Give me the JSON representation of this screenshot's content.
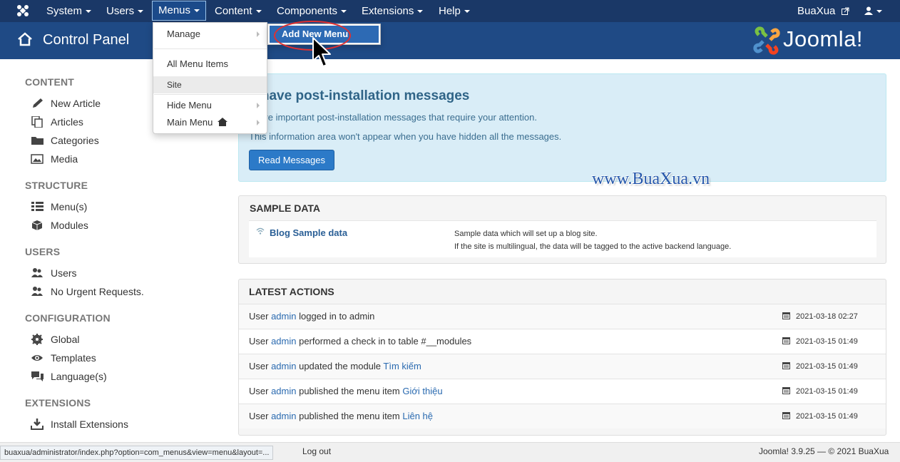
{
  "navbar": {
    "items": [
      {
        "label": "System"
      },
      {
        "label": "Users"
      },
      {
        "label": "Menus"
      },
      {
        "label": "Content"
      },
      {
        "label": "Components"
      },
      {
        "label": "Extensions"
      },
      {
        "label": "Help"
      }
    ],
    "site_link": "BuaXua",
    "user_icon": "user-icon"
  },
  "header": {
    "title": "Control Panel",
    "brand": "Joomla!"
  },
  "menus_dropdown": {
    "items": [
      {
        "label": "Manage",
        "has_submenu": true
      },
      {
        "label": "All Menu Items"
      },
      {
        "label": "Site"
      },
      {
        "label": "Hide Menu",
        "has_submenu": true
      },
      {
        "label": "Main Menu",
        "has_submenu": true
      }
    ],
    "submenu": {
      "label": "Add New Menu"
    }
  },
  "sidebar": {
    "sections": [
      {
        "heading": "CONTENT",
        "items": [
          {
            "label": "New Article",
            "icon": "pencil-icon"
          },
          {
            "label": "Articles",
            "icon": "copy-icon"
          },
          {
            "label": "Categories",
            "icon": "folder-icon"
          },
          {
            "label": "Media",
            "icon": "image-icon"
          }
        ]
      },
      {
        "heading": "STRUCTURE",
        "items": [
          {
            "label": "Menu(s)",
            "icon": "list-icon"
          },
          {
            "label": "Modules",
            "icon": "cube-icon"
          }
        ]
      },
      {
        "heading": "USERS",
        "items": [
          {
            "label": "Users",
            "icon": "users-icon"
          },
          {
            "label": "No Urgent Requests.",
            "icon": "users-icon"
          }
        ]
      },
      {
        "heading": "CONFIGURATION",
        "items": [
          {
            "label": "Global",
            "icon": "cog-icon"
          },
          {
            "label": "Templates",
            "icon": "eye-icon"
          },
          {
            "label": "Language(s)",
            "icon": "comments-icon"
          }
        ]
      },
      {
        "heading": "EXTENSIONS",
        "items": [
          {
            "label": "Install Extensions",
            "icon": "download-icon"
          }
        ]
      }
    ]
  },
  "alert": {
    "title": "u have post-installation messages",
    "line1": "re are important post-installation messages that require your attention.",
    "line2": "This information area won't appear when you have hidden all the messages.",
    "button": "Read Messages"
  },
  "watermark": "www.BuaXua.vn",
  "sample_data": {
    "heading": "SAMPLE DATA",
    "link": "Blog Sample data",
    "desc1": "Sample data which will set up a blog site.",
    "desc2": "If the site is multilingual, the data will be tagged to the active backend language."
  },
  "latest_actions": {
    "heading": "LATEST ACTIONS",
    "rows": [
      {
        "pre": "User ",
        "user": "admin",
        "mid": " logged in to admin",
        "target": "",
        "date": "2021-03-18 02:27"
      },
      {
        "pre": "User ",
        "user": "admin",
        "mid": " performed a check in to table #__modules",
        "target": "",
        "date": "2021-03-15 01:49"
      },
      {
        "pre": "User ",
        "user": "admin",
        "mid": " updated the module ",
        "target": "Tìm kiếm",
        "date": "2021-03-15 01:49"
      },
      {
        "pre": "User ",
        "user": "admin",
        "mid": " published the menu item ",
        "target": "Giới thiệu",
        "date": "2021-03-15 01:49"
      },
      {
        "pre": "User ",
        "user": "admin",
        "mid": " published the menu item ",
        "target": "Liên hệ",
        "date": "2021-03-15 01:49"
      }
    ]
  },
  "footer": {
    "status_url": "buaxua/administrator/index.php?option=com_menus&view=menu&layout=...",
    "logout": "Log out",
    "copyright": "Joomla! 3.9.25  —  © 2021 BuaXua"
  }
}
